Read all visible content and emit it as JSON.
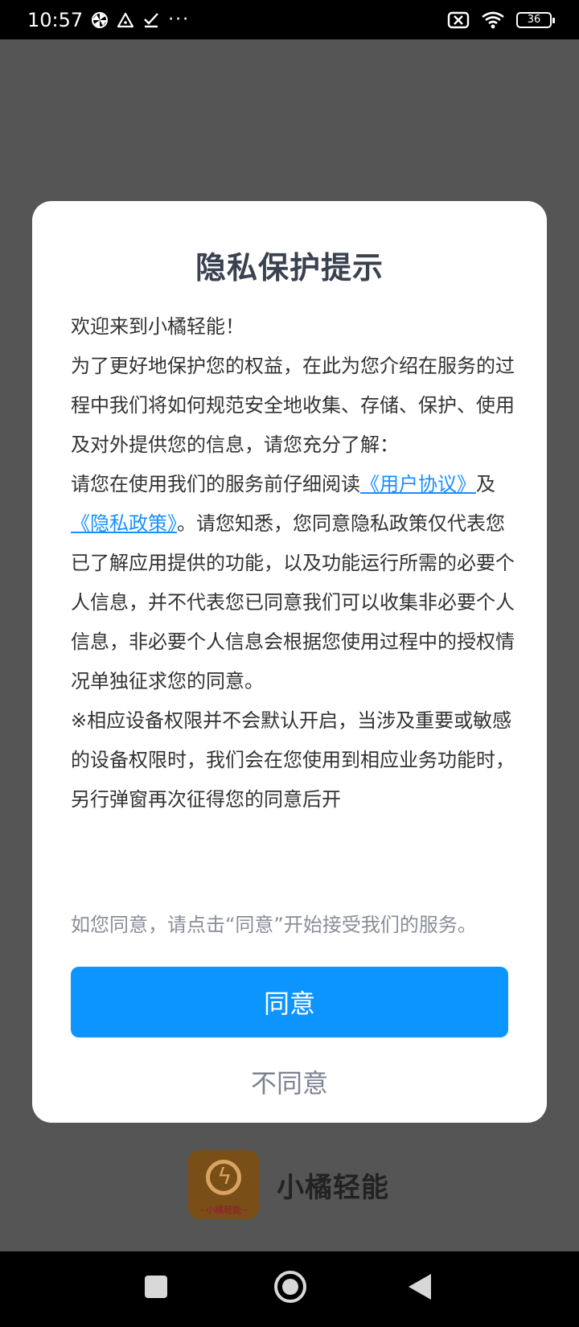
{
  "status_bar": {
    "time": "10:57",
    "battery": "36",
    "left_icons": [
      "pinwheel-icon",
      "warning-triangle-icon",
      "check-icon",
      "more-dots-icon"
    ],
    "right_icons": [
      "sim-blocked-icon",
      "wifi-icon",
      "battery-icon"
    ],
    "dots": "···"
  },
  "dialog": {
    "title": "隐私保护提示",
    "welcome": "欢迎来到小橘轻能！",
    "para1": "为了更好地保护您的权益，在此为您介绍在服务的过程中我们将如何规范安全地收集、存储、保护、使用及对外提供您的信息，请您充分了解：",
    "para2_prefix": "请您在使用我们的服务前仔细阅读",
    "user_agreement_link": "《用户协议》",
    "and": "及",
    "privacy_policy_link": "《隐私政策》",
    "para2_suffix": "。请您知悉，您同意隐私政策仅代表您已了解应用提供的功能，以及功能运行所需的必要个人信息，并不代表您已同意我们可以收集非必要个人信息，非必要个人信息会根据您使用过程中的授权情况单独征求您的同意。",
    "para3": "※相应设备权限并不会默认开启，当涉及重要或敏感的设备权限时，我们会在您使用到相应业务功能时，另行弹窗再次征得您的同意后开",
    "consent_note": "如您同意，请点击“同意”开始接受我们的服务。",
    "agree_label": "同意",
    "disagree_label": "不同意"
  },
  "brand": {
    "name": "小橘轻能",
    "logo_text": "~小橘轻能~",
    "bolt": "ϟ"
  },
  "colors": {
    "accent": "#0d95ff",
    "link": "#1890ff",
    "overlay": "#555555"
  }
}
